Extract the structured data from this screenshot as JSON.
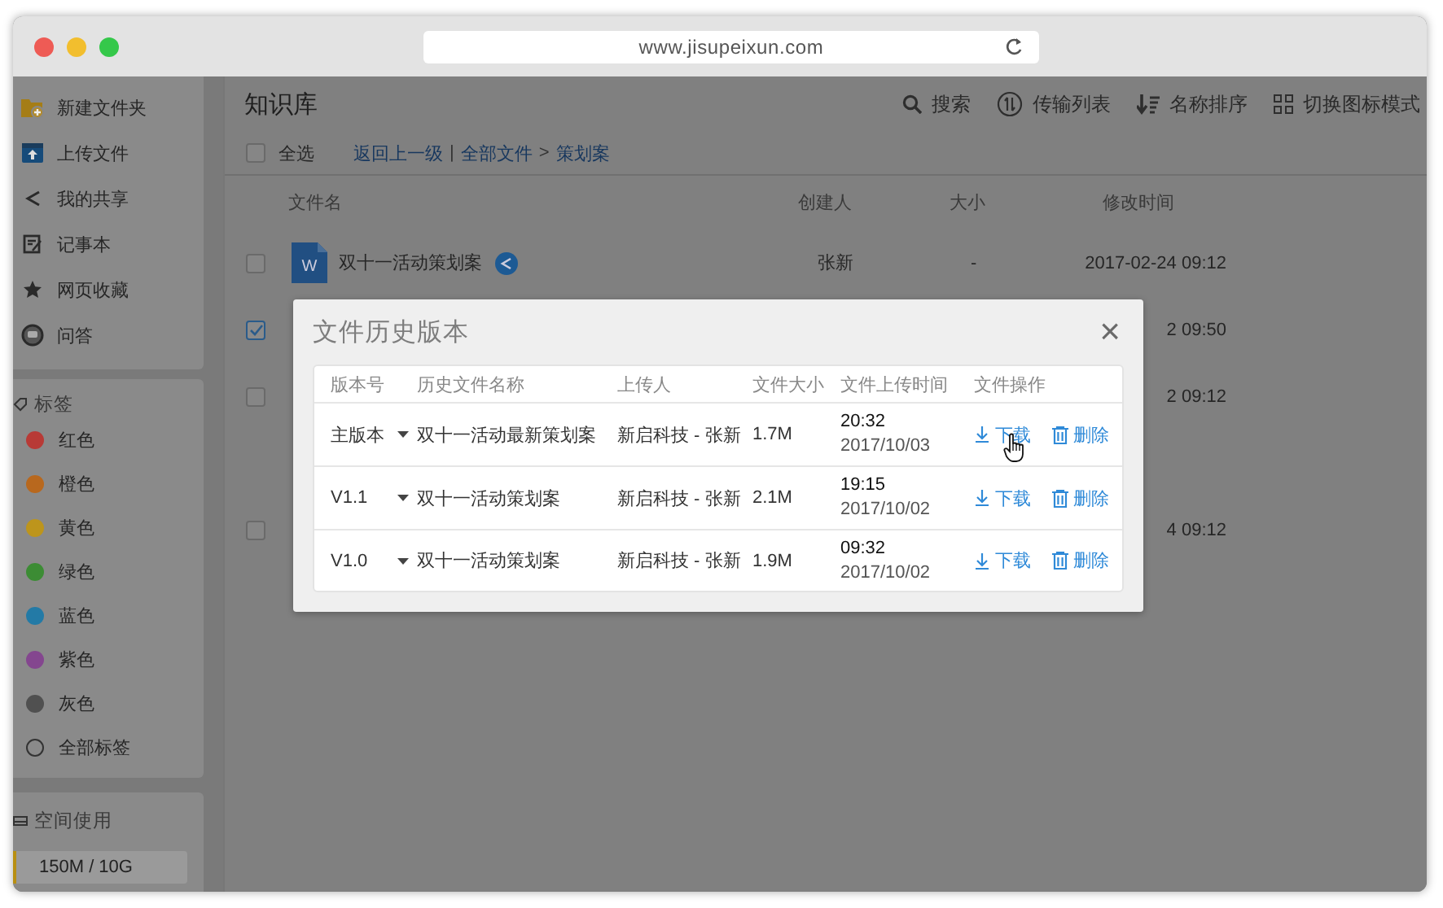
{
  "browser": {
    "url": "www.jisupeixun.com"
  },
  "sidebar": {
    "actions": [
      {
        "label": "新建文件夹",
        "kind": "new-folder"
      },
      {
        "label": "上传文件",
        "kind": "upload"
      },
      {
        "label": "我的共享",
        "kind": "share"
      },
      {
        "label": "记事本",
        "kind": "notes"
      },
      {
        "label": "网页收藏",
        "kind": "star"
      },
      {
        "label": "问答",
        "kind": "chat"
      }
    ],
    "tags_title": "标签",
    "tags": [
      {
        "label": "红色",
        "kind": "dot",
        "color": "#b83a36"
      },
      {
        "label": "橙色",
        "kind": "dot",
        "color": "#b8681e"
      },
      {
        "label": "黄色",
        "kind": "dot",
        "color": "#bd951c"
      },
      {
        "label": "绿色",
        "kind": "dot",
        "color": "#3c8c34"
      },
      {
        "label": "蓝色",
        "kind": "dot",
        "color": "#237aa6"
      },
      {
        "label": "紫色",
        "kind": "dot",
        "color": "#84468f"
      },
      {
        "label": "灰色",
        "kind": "dot",
        "color": "#505050"
      },
      {
        "label": "全部标签",
        "kind": "all"
      }
    ],
    "storage": {
      "title": "空间使用",
      "reading": "150M / 10G",
      "level": 0.02
    }
  },
  "main": {
    "title": "知识库",
    "tools": [
      {
        "label": "搜索",
        "kind": "search"
      },
      {
        "label": "传输列表",
        "kind": "transfer"
      },
      {
        "label": "名称排序",
        "kind": "sort"
      },
      {
        "label": "切换图标模式",
        "kind": "grid"
      }
    ],
    "select_all": {
      "label": "全选",
      "checked": false
    },
    "breadcrumb": [
      {
        "text": "返回上一级",
        "kind": "link"
      },
      {
        "text": "|",
        "kind": "sep"
      },
      {
        "text": "全部文件",
        "kind": "link"
      },
      {
        "text": ">",
        "kind": "sep"
      },
      {
        "text": "策划案",
        "kind": "link"
      }
    ],
    "columns": [
      "文件名",
      "创建人",
      "大小",
      "修改时间"
    ],
    "rows": [
      {
        "checked": false,
        "icon_letter": "W",
        "name": "双十一活动策划案",
        "shared": true,
        "creator": "张新",
        "size": "-",
        "modified": "2017-02-24 09:12"
      },
      {
        "checked": true,
        "modified": "2 09:50"
      },
      {
        "checked": false,
        "modified": "2 09:12"
      },
      {
        "checked": false,
        "modified": "4 09:12"
      }
    ]
  },
  "dialog": {
    "title": "文件历史版本",
    "close": "×",
    "columns": [
      "版本号",
      "历史文件名称",
      "上传人",
      "文件大小",
      "文件上传时间",
      "文件操作"
    ],
    "versions": [
      {
        "version": "主版本",
        "name": "双十一活动最新策划案",
        "uploader": "新启科技 - 张新",
        "size": "1.7M",
        "time": "20:32",
        "date": "2017/10/03",
        "download": "下载",
        "delete": "删除",
        "hovered": true
      },
      {
        "version": "V1.1",
        "name": "双十一活动策划案",
        "uploader": "新启科技 - 张新",
        "size": "2.1M",
        "time": "19:15",
        "date": "2017/10/02",
        "download": "下载",
        "delete": "删除",
        "hovered": false
      },
      {
        "version": "V1.0",
        "name": "双十一活动策划案",
        "uploader": "新启科技 - 张新",
        "size": "1.9M",
        "time": "09:32",
        "date": "2017/10/02",
        "download": "下载",
        "delete": "删除",
        "hovered": false
      }
    ]
  }
}
